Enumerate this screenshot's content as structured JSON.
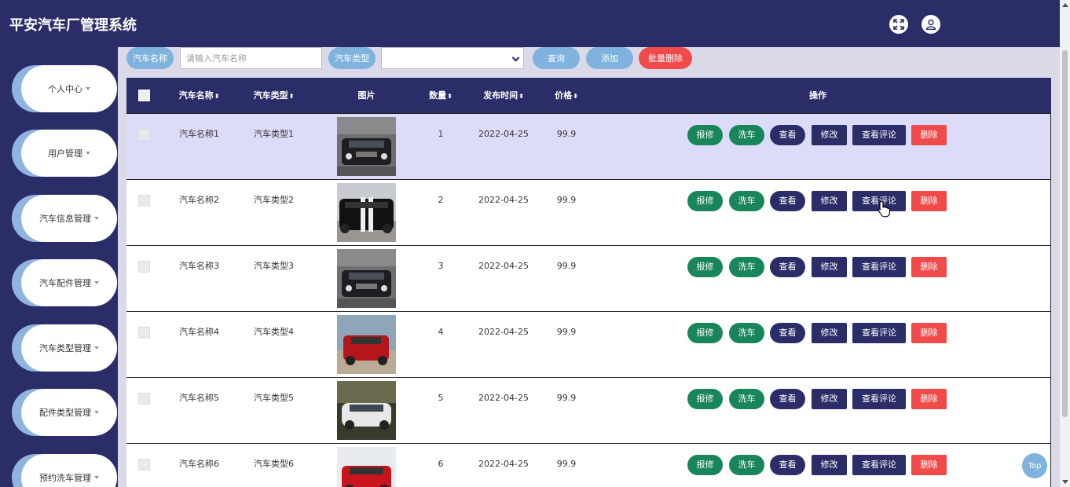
{
  "app": {
    "title": "平安汽车厂管理系统"
  },
  "header_icons": [
    "fullscreen-icon",
    "user-icon"
  ],
  "sidebar": {
    "items": [
      {
        "label": "个人中心"
      },
      {
        "label": "用户管理"
      },
      {
        "label": "汽车信息管理"
      },
      {
        "label": "汽车配件管理"
      },
      {
        "label": "汽车类型管理"
      },
      {
        "label": "配件类型管理"
      },
      {
        "label": "预约洗车管理"
      }
    ]
  },
  "search": {
    "name_label": "汽车名称",
    "name_placeholder": "请输入汽车名称",
    "type_label": "汽车类型",
    "type_value": "",
    "query_button": "查询",
    "add_button": "添加",
    "batch_delete_button": "批量删除"
  },
  "table": {
    "columns": {
      "name": "汽车名称",
      "type": "汽车类型",
      "image": "图片",
      "quantity": "数量",
      "date": "发布时间",
      "price": "价格",
      "actions": "操作"
    },
    "sort_glyph": "⬍",
    "rows": [
      {
        "name": "汽车名称1",
        "type": "汽车类型1",
        "image": "dark-sedan-photo",
        "quantity": "1",
        "date": "2022-04-25",
        "price": "99.9"
      },
      {
        "name": "汽车名称2",
        "type": "汽车类型2",
        "image": "black-muscle-car-photo",
        "quantity": "2",
        "date": "2022-04-25",
        "price": "99.9"
      },
      {
        "name": "汽车名称3",
        "type": "汽车类型3",
        "image": "dark-sedan-photo",
        "quantity": "3",
        "date": "2022-04-25",
        "price": "99.9"
      },
      {
        "name": "汽车名称4",
        "type": "汽车类型4",
        "image": "red-suv-photo",
        "quantity": "4",
        "date": "2022-04-25",
        "price": "99.9"
      },
      {
        "name": "汽车名称5",
        "type": "汽车类型5",
        "image": "white-sedan-photo",
        "quantity": "5",
        "date": "2022-04-25",
        "price": "99.9"
      },
      {
        "name": "汽车名称6",
        "type": "汽车类型6",
        "image": "red-suv-photo",
        "quantity": "6",
        "date": "2022-04-25",
        "price": "99.9"
      }
    ],
    "actions": {
      "repair": "报修",
      "wash": "洗车",
      "view": "查看",
      "edit": "修改",
      "comments": "查看评论",
      "delete": "删除"
    }
  },
  "top_button": "Top",
  "colors": {
    "navy": "#2b2d68",
    "light_blue": "#7fb3dd",
    "green": "#19855a",
    "red": "#f04a4a",
    "highlight_row": "#dcdcf8"
  }
}
